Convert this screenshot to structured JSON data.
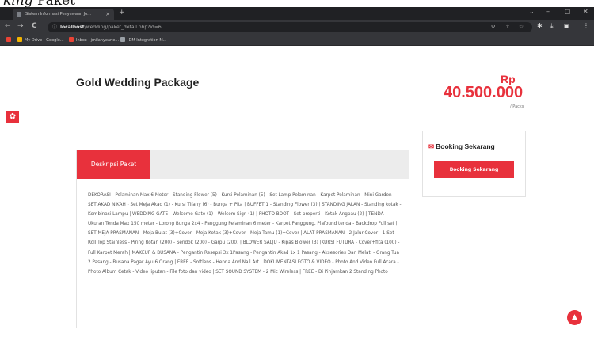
{
  "caption_fragment": {
    "italic": "king",
    "text": " Paket"
  },
  "browser": {
    "tab_title": "Sistem Informasi Penyewaan Jo...",
    "tab_close": "×",
    "new_tab": "+",
    "window_controls": [
      "⌄",
      "–",
      "▢",
      "✕"
    ],
    "nav": {
      "back": "←",
      "forward": "→",
      "reload": "C"
    },
    "address": {
      "host": "localhost",
      "path": "/wedding/paket_detail.php?id=6"
    },
    "omnibox_icons": [
      "⚲",
      "⇧",
      "☆"
    ],
    "toolbar_icons": [
      "✱",
      "⤓",
      "▣",
      "⋮"
    ],
    "bookmarks": [
      {
        "label": "My Drive - Google...",
        "color": "#f4b400"
      },
      {
        "label": "Inbox - jmilanyeane...",
        "color": "#ea4335"
      },
      {
        "label": "IDM Integration M...",
        "color": "#9aa0a6"
      }
    ]
  },
  "page": {
    "gear_glyph": "✿",
    "package_title": "Gold Wedding Package",
    "price": {
      "currency": "Rp",
      "amount": "40.500.000",
      "unit": "/ Packs"
    },
    "tabs": [
      {
        "label": "Deskripsi Paket",
        "active": true
      }
    ],
    "description": "DEKORASI - Pelaminan Max 6 Meter - Standing Flower (5) - Kursi Pelaminan (5) - Set Lamp Pelaminan - Karpet Pelaminan - Mini Garden | SET AKAD NIKAH - Set Meja Akad (1) - Kursi Tifany (6) - Bunga + Pita | BUFFET 1 - Standing Flower (3) | STANDING JALAN - Standing kotak - Kombinasi Lampu | WEDDING GATE - Welcome Gate (1) - Welcom Sign (1) | PHOTO BOOT - Set properti - Kotak Angpau (2) | TENDA - Ukuran Tenda Max 150 meter - Lorong Bunga 2x4 - Panggung Pelaminan 6 meter - Karpet Panggung, Plafound tenda - Backdrop Full set | SET MEJA PRASMANAN - Meja Bulat (3)+Cover - Meja Kotak (3)+Cover - Meja Tamu (1)+Cover | ALAT PRASMANAN - 2 Jalur-Cover - 1 Set Roll Top Stainless - Piring Rotan (200) - Sendok (200) - Garpu (200) | BLOWER SALJU - Kipas Blower (3) |KURSI FUTURA - Cover+fita (100) - Full Karpet Merah | MAKEUP & BUSANA - Pengantin Resepsi 3x 1Pasang - Pengantin Akad 1x 1 Pasang - Aksesories Dan Melati - Orang Tua 2 Pasang - Busana Pagar Ayu 6 Orang | FREE - Softlens - Henna And Nail Art | DOKUMENTASI FOTO & VIDEO - Photo And Video Full Acara - Photo Album Cetak - Video liputan - File foto dan video | SET SOUND SYSTEM - 2 Mic Wireless | FREE - Di Pinjamkan 2 Standing Photo",
    "booking": {
      "title": "Booking Sekarang",
      "title_icon": "✉",
      "button": "Booking Sekarang"
    },
    "scroll_top_glyph": "▲",
    "accent_color": "#e8313c"
  }
}
